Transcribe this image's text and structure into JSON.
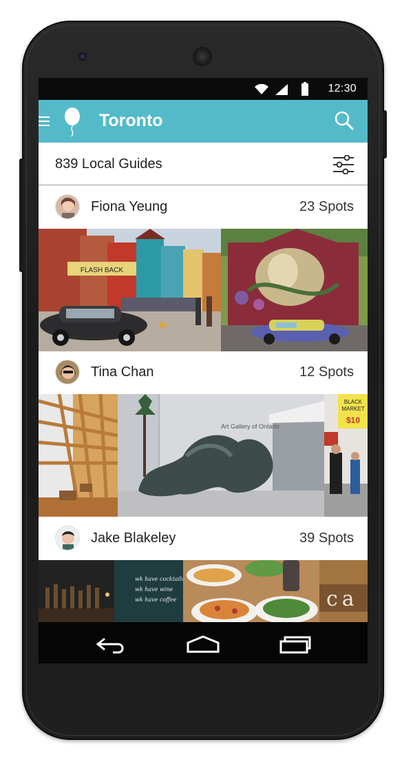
{
  "status_bar": {
    "time": "12:30"
  },
  "app_bar": {
    "title": "Toronto"
  },
  "subheader": {
    "guides_count_label": "839 Local Guides"
  },
  "guides": [
    {
      "name": "Fiona Yeung",
      "spots": "23 Spots"
    },
    {
      "name": "Tina Chan",
      "spots": "12 Spots"
    },
    {
      "name": "Jake Blakeley",
      "spots": "39 Spots"
    }
  ],
  "photo_texts": {
    "shop_sign": "FLASH BACK",
    "gallery_sign": "Art Gallery of Ontario",
    "market_sign_1": "BLACK",
    "market_sign_2": "MARKET",
    "market_price": "$10",
    "chalk_1": "wk have cocktails",
    "chalk_2": "wk have wine",
    "chalk_3": "wk have coffee",
    "cafe_sign": "ca"
  },
  "colors": {
    "app_bar": "#54bac9",
    "status_bar": "#0b0b0b",
    "nav_bar": "#050505"
  },
  "icons": [
    "menu-icon",
    "balloon-icon",
    "search-icon",
    "filter-icon",
    "wifi-icon",
    "signal-icon",
    "battery-icon",
    "back-icon",
    "home-icon",
    "recents-icon"
  ]
}
